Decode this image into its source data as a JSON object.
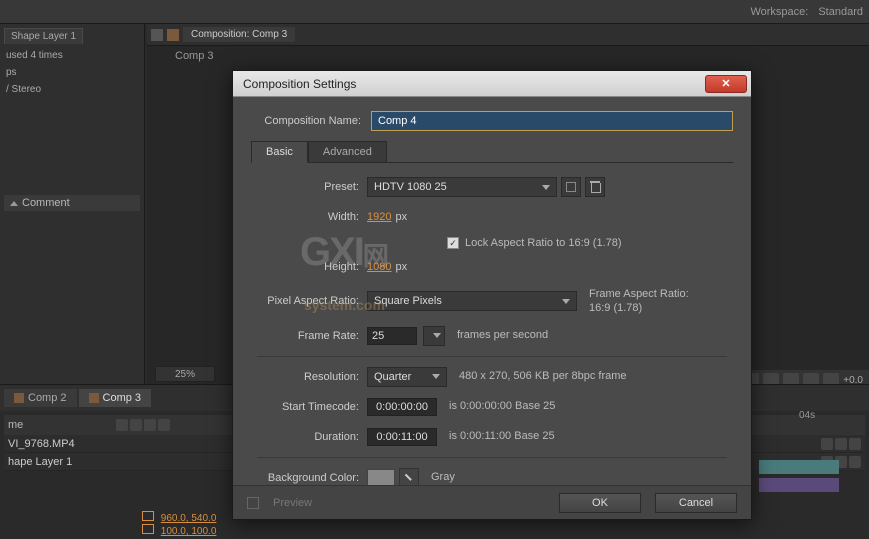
{
  "app": {
    "workspace_label": "Workspace:",
    "workspace_value": "Standard"
  },
  "leftPanel": {
    "tab": "Shape Layer 1",
    "used_text": "used 4 times",
    "ps_text": "ps",
    "stereo_text": "/ Stereo",
    "comment_header": "Comment"
  },
  "viewer": {
    "tab_prefix": "Composition: ",
    "tab_name": "Comp 3",
    "sub_tab": "Comp 3"
  },
  "zoom": "25%",
  "timeline": {
    "tabs": [
      {
        "label": "Comp 2",
        "active": false
      },
      {
        "label": "Comp 3",
        "active": true
      }
    ],
    "col_name": "me",
    "rows": [
      {
        "name": "VI_9768.MP4"
      },
      {
        "name": "hape Layer 1"
      }
    ],
    "footer_a": "960.0, 540.0",
    "footer_b": "100.0, 100.0",
    "ruler_label": "04s"
  },
  "dialog": {
    "title": "Composition Settings",
    "comp_name_label": "Composition Name:",
    "comp_name_value": "Comp 4",
    "tab_basic": "Basic",
    "tab_advanced": "Advanced",
    "preset_label": "Preset:",
    "preset_value": "HDTV 1080 25",
    "width_label": "Width:",
    "width_value": "1920",
    "height_label": "Height:",
    "height_value": "1080",
    "px_unit": "px",
    "lock_aspect": "Lock Aspect Ratio to 16:9 (1.78)",
    "par_label": "Pixel Aspect Ratio:",
    "par_value": "Square Pixels",
    "far_label": "Frame Aspect Ratio:",
    "far_value": "16:9 (1.78)",
    "fr_label": "Frame Rate:",
    "fr_value": "25",
    "fr_suffix": "frames per second",
    "res_label": "Resolution:",
    "res_value": "Quarter",
    "res_info": "480 x 270, 506 KB per 8bpc frame",
    "start_label": "Start Timecode:",
    "start_value": "0:00:00:00",
    "start_info": "is 0:00:00:00  Base 25",
    "dur_label": "Duration:",
    "dur_value": "0:00:11:00",
    "dur_info": "is 0:00:11:00  Base 25",
    "bg_label": "Background Color:",
    "bg_name": "Gray",
    "preview": "Preview",
    "ok": "OK",
    "cancel": "Cancel"
  },
  "watermark": {
    "big": "GXI",
    "sub": "system.com",
    "tag": "网"
  }
}
